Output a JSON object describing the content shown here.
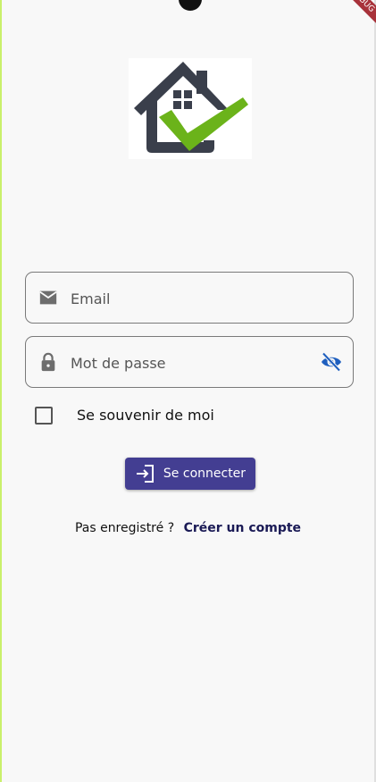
{
  "debug_banner": "DEBUG",
  "form": {
    "email_placeholder": "Email",
    "password_placeholder": "Mot de passe",
    "remember_label": "Se souvenir de moi",
    "remember_checked": false,
    "login_button_label": "Se connecter"
  },
  "signup": {
    "prompt": "Pas enregistré ?",
    "link_label": "Créer un compte"
  },
  "colors": {
    "primary": "#433e92",
    "link": "#1a1a55",
    "eye_icon": "#1f5fbf",
    "logo_house": "#3a3f4b",
    "logo_check": "#6bb31a"
  },
  "icons": [
    "email-icon",
    "lock-icon",
    "visibility-off-icon",
    "login-icon",
    "house-check-logo"
  ]
}
